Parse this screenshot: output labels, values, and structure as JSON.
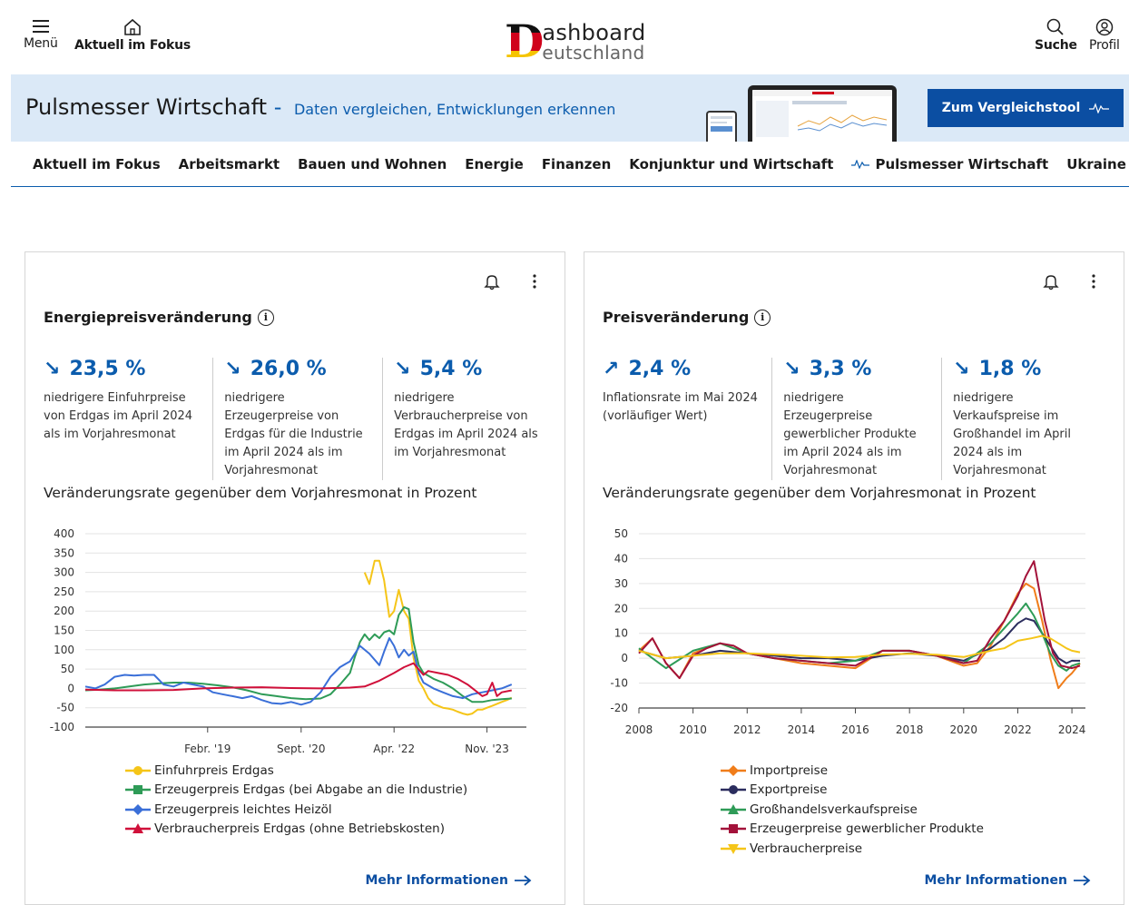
{
  "header": {
    "menu_label": "Menü",
    "focus_label": "Aktuell im Fokus",
    "logo_d": "D",
    "logo_line1": "ashboard",
    "logo_line2": "eutschland",
    "search_label": "Suche",
    "profile_label": "Profil"
  },
  "banner": {
    "title": "Pulsmesser Wirtschaft",
    "dash": " - ",
    "subtitle": "Daten vergleichen, Entwicklungen erkennen",
    "button_label": "Zum Vergleichstool"
  },
  "tabs": [
    {
      "label": "Aktuell im Fokus"
    },
    {
      "label": "Arbeitsmarkt"
    },
    {
      "label": "Bauen und Wohnen"
    },
    {
      "label": "Energie"
    },
    {
      "label": "Finanzen"
    },
    {
      "label": "Konjunktur und Wirtschaft"
    },
    {
      "label": "Pulsmesser Wirtschaft"
    },
    {
      "label": "Ukraine"
    }
  ],
  "cards": [
    {
      "title": "Energiepreisveränderung",
      "kpis": [
        {
          "arrow": "↘",
          "value": "23,5 %",
          "text": "niedrigere Einfuhrpreise von Erdgas im April 2024 als im Vorjahresmonat"
        },
        {
          "arrow": "↘",
          "value": "26,0 %",
          "text": "niedrigere Erzeugerpreise von Erdgas für die Industrie im April 2024 als im Vorjahresmonat"
        },
        {
          "arrow": "↘",
          "value": "5,4 %",
          "text": "niedrigere Verbraucherpreise von Erdgas im April 2024 als im Vorjahresmonat"
        }
      ],
      "chart_title": "Veränderungsrate gegenüber dem Vorjahresmonat in Prozent",
      "more": "Mehr Informationen"
    },
    {
      "title": "Preisveränderung",
      "kpis": [
        {
          "arrow": "↗",
          "value": "2,4 %",
          "text": "Inflationsrate im Mai 2024 (vorläufiger Wert)"
        },
        {
          "arrow": "↘",
          "value": "3,3 %",
          "text": "niedrigere Erzeugerpreise gewerblicher Produkte im April 2024 als im Vorjahresmonat"
        },
        {
          "arrow": "↘",
          "value": "1,8 %",
          "text": "niedrigere Verkaufspreise im Großhandel im April 2024 als im Vorjahresmonat"
        }
      ],
      "chart_title": "Veränderungsrate gegenüber dem Vorjahresmonat in Prozent",
      "more": "Mehr Informationen"
    }
  ],
  "colors": {
    "accent": "#0b5cad",
    "button": "#0b4ea2",
    "banner_bg": "#dbe9f7"
  },
  "chart_data": [
    {
      "type": "line",
      "title": "Veränderungsrate gegenüber dem Vorjahresmonat in Prozent",
      "ylim": [
        -100,
        400
      ],
      "yticks": [
        -100,
        -50,
        0,
        50,
        100,
        150,
        200,
        250,
        300,
        350,
        400
      ],
      "xticks": [
        {
          "label": "Febr. '19",
          "x": 2019.08
        },
        {
          "label": "Sept. '20",
          "x": 2020.67
        },
        {
          "label": "Apr. '22",
          "x": 2022.25
        },
        {
          "label": "Nov. '23",
          "x": 2023.83
        }
      ],
      "xlim": [
        2017.0,
        2024.5
      ],
      "grid": true,
      "legend_position": "bottom",
      "series": [
        {
          "name": "Einfuhrpreis Erdgas",
          "color": "#f5c518",
          "marker": "circle",
          "x": [
            2021.75,
            2021.83,
            2021.92,
            2022.0,
            2022.08,
            2022.17,
            2022.25,
            2022.33,
            2022.42,
            2022.5,
            2022.58,
            2022.67,
            2022.75,
            2022.83,
            2022.92,
            2023.0,
            2023.08,
            2023.17,
            2023.25,
            2023.33,
            2023.42,
            2023.5,
            2023.58,
            2023.67,
            2023.75,
            2023.83,
            2023.92,
            2024.0,
            2024.08,
            2024.17,
            2024.25
          ],
          "y": [
            300,
            270,
            330,
            330,
            280,
            185,
            200,
            255,
            200,
            180,
            80,
            20,
            0,
            -25,
            -40,
            -45,
            -50,
            -52,
            -55,
            -60,
            -65,
            -68,
            -65,
            -55,
            -55,
            -50,
            -45,
            -40,
            -35,
            -30,
            -24
          ]
        },
        {
          "name": "Erzeugerpreis Erdgas (bei Abgabe an die Industrie)",
          "color": "#2e9b57",
          "marker": "square",
          "x": [
            2017.0,
            2017.25,
            2017.5,
            2017.75,
            2018.0,
            2018.25,
            2018.5,
            2018.75,
            2019.0,
            2019.25,
            2019.5,
            2019.75,
            2020.0,
            2020.25,
            2020.5,
            2020.75,
            2021.0,
            2021.17,
            2021.33,
            2021.5,
            2021.58,
            2021.67,
            2021.75,
            2021.83,
            2021.92,
            2022.0,
            2022.08,
            2022.17,
            2022.25,
            2022.33,
            2022.42,
            2022.5,
            2022.58,
            2022.67,
            2022.75,
            2022.92,
            2023.08,
            2023.25,
            2023.42,
            2023.58,
            2023.75,
            2023.92,
            2024.08,
            2024.25
          ],
          "y": [
            -5,
            -3,
            0,
            5,
            10,
            13,
            15,
            15,
            12,
            8,
            3,
            -5,
            -15,
            -20,
            -25,
            -28,
            -26,
            -15,
            10,
            40,
            80,
            120,
            140,
            125,
            140,
            130,
            145,
            150,
            140,
            190,
            210,
            205,
            120,
            60,
            40,
            25,
            15,
            0,
            -20,
            -35,
            -35,
            -30,
            -28,
            -26
          ]
        },
        {
          "name": "Erzeugerpreis leichtes Heizöl",
          "color": "#3a6fd8",
          "marker": "diamond",
          "x": [
            2017.0,
            2017.17,
            2017.33,
            2017.5,
            2017.67,
            2017.83,
            2018.0,
            2018.17,
            2018.33,
            2018.5,
            2018.67,
            2018.83,
            2019.0,
            2019.17,
            2019.33,
            2019.5,
            2019.67,
            2019.83,
            2020.0,
            2020.17,
            2020.33,
            2020.5,
            2020.67,
            2020.83,
            2021.0,
            2021.17,
            2021.33,
            2021.5,
            2021.67,
            2021.83,
            2022.0,
            2022.08,
            2022.17,
            2022.25,
            2022.33,
            2022.42,
            2022.5,
            2022.58,
            2022.67,
            2022.75,
            2022.92,
            2023.08,
            2023.25,
            2023.42,
            2023.58,
            2023.75,
            2023.92,
            2024.08,
            2024.25
          ],
          "y": [
            5,
            0,
            10,
            30,
            35,
            33,
            35,
            35,
            10,
            5,
            15,
            10,
            5,
            -10,
            -15,
            -20,
            -25,
            -20,
            -30,
            -38,
            -40,
            -35,
            -42,
            -35,
            -10,
            30,
            55,
            70,
            110,
            90,
            60,
            95,
            130,
            110,
            80,
            100,
            85,
            95,
            40,
            15,
            0,
            -10,
            -20,
            -25,
            -15,
            -10,
            -5,
            0,
            10
          ]
        },
        {
          "name": "Verbraucherpreis Erdgas (ohne Betriebskosten)",
          "color": "#d0103a",
          "marker": "triangle",
          "x": [
            2017.0,
            2017.5,
            2018.0,
            2018.5,
            2019.0,
            2019.5,
            2020.0,
            2020.5,
            2021.0,
            2021.5,
            2021.75,
            2022.0,
            2022.25,
            2022.42,
            2022.58,
            2022.75,
            2022.83,
            2023.0,
            2023.17,
            2023.33,
            2023.5,
            2023.67,
            2023.75,
            2023.83,
            2023.92,
            2024.0,
            2024.08,
            2024.25
          ],
          "y": [
            -3,
            -5,
            -5,
            -4,
            0,
            2,
            3,
            1,
            0,
            2,
            5,
            20,
            40,
            55,
            65,
            35,
            45,
            40,
            35,
            25,
            10,
            -10,
            -20,
            -15,
            15,
            -20,
            -10,
            -5
          ]
        }
      ]
    },
    {
      "type": "line",
      "title": "Veränderungsrate gegenüber dem Vorjahresmonat in Prozent",
      "ylim": [
        -20,
        50
      ],
      "yticks": [
        -20,
        -10,
        0,
        10,
        20,
        30,
        40,
        50
      ],
      "xticks": [
        {
          "label": "2008",
          "x": 2008
        },
        {
          "label": "2010",
          "x": 2010
        },
        {
          "label": "2012",
          "x": 2012
        },
        {
          "label": "2014",
          "x": 2014
        },
        {
          "label": "2016",
          "x": 2016
        },
        {
          "label": "2018",
          "x": 2018
        },
        {
          "label": "2020",
          "x": 2020
        },
        {
          "label": "2022",
          "x": 2022
        },
        {
          "label": "2024",
          "x": 2024
        }
      ],
      "xlim": [
        2008,
        2024.5
      ],
      "grid": true,
      "legend_position": "bottom",
      "series": [
        {
          "name": "Importpreise",
          "color": "#f07d1a",
          "marker": "diamond",
          "x": [
            2008,
            2008.5,
            2009,
            2009.5,
            2010,
            2011,
            2012,
            2013,
            2014,
            2015,
            2016,
            2017,
            2018,
            2019,
            2020,
            2020.5,
            2021,
            2021.5,
            2022,
            2022.3,
            2022.6,
            2022.9,
            2023.2,
            2023.5,
            2023.8,
            2024,
            2024.3
          ],
          "y": [
            3,
            8,
            -2,
            -8,
            2,
            6,
            2,
            0,
            -2,
            -3,
            -4,
            3,
            3,
            1,
            -3,
            -2,
            5,
            15,
            26,
            30,
            28,
            15,
            0,
            -12,
            -8,
            -6,
            -2
          ]
        },
        {
          "name": "Exportpreise",
          "color": "#2b2d5e",
          "marker": "circle",
          "x": [
            2008,
            2009,
            2010,
            2011,
            2012,
            2013,
            2014,
            2015,
            2016,
            2017,
            2018,
            2019,
            2020,
            2021,
            2021.5,
            2022,
            2022.3,
            2022.6,
            2022.9,
            2023.2,
            2023.5,
            2023.8,
            2024,
            2024.3
          ],
          "y": [
            3,
            0,
            1,
            3,
            2,
            1,
            0,
            0,
            -1,
            1,
            2,
            1,
            -1,
            4,
            8,
            14,
            16,
            15,
            10,
            5,
            0,
            -2,
            -1,
            -1
          ]
        },
        {
          "name": "Großhandelsverkaufspreise",
          "color": "#2e9b57",
          "marker": "triangle",
          "x": [
            2008,
            2009,
            2010,
            2011,
            2012,
            2013,
            2014,
            2015,
            2016,
            2017,
            2018,
            2019,
            2020,
            2021,
            2021.5,
            2022,
            2022.3,
            2022.6,
            2022.9,
            2023.2,
            2023.5,
            2023.8,
            2024,
            2024.3
          ],
          "y": [
            4,
            -4,
            3,
            6,
            2,
            0,
            -1,
            -2,
            -1,
            3,
            3,
            1,
            -2,
            6,
            12,
            18,
            22,
            17,
            10,
            2,
            -3,
            -5,
            -3,
            -2
          ]
        },
        {
          "name": "Erzeugerpreise gewerblicher Produkte",
          "color": "#a3123a",
          "marker": "square",
          "x": [
            2008,
            2008.5,
            2009,
            2009.5,
            2010,
            2010.5,
            2011,
            2011.5,
            2012,
            2013,
            2014,
            2015,
            2016,
            2017,
            2018,
            2019,
            2020,
            2020.5,
            2021,
            2021.5,
            2022,
            2022.3,
            2022.6,
            2022.75,
            2023,
            2023.3,
            2023.6,
            2024,
            2024.3
          ],
          "y": [
            2,
            8,
            -2,
            -8,
            1,
            4,
            6,
            5,
            2,
            0,
            -1,
            -2,
            -3,
            3,
            3,
            1,
            -2,
            -1,
            8,
            15,
            25,
            33,
            39,
            30,
            15,
            2,
            -3,
            -4,
            -3
          ]
        },
        {
          "name": "Verbraucherpreise",
          "color": "#f5c518",
          "marker": "triangle-down",
          "x": [
            2008,
            2009,
            2010,
            2011,
            2012,
            2013,
            2014,
            2015,
            2016,
            2017,
            2018,
            2019,
            2020,
            2021,
            2021.5,
            2022,
            2022.5,
            2022.9,
            2023.2,
            2023.5,
            2023.8,
            2024,
            2024.3
          ],
          "y": [
            3,
            0,
            1,
            2,
            2,
            1.5,
            1,
            0.3,
            0.5,
            1.5,
            1.8,
            1.4,
            0.5,
            3,
            4,
            7,
            8,
            9,
            8,
            6,
            4,
            3,
            2.4
          ]
        }
      ]
    }
  ]
}
